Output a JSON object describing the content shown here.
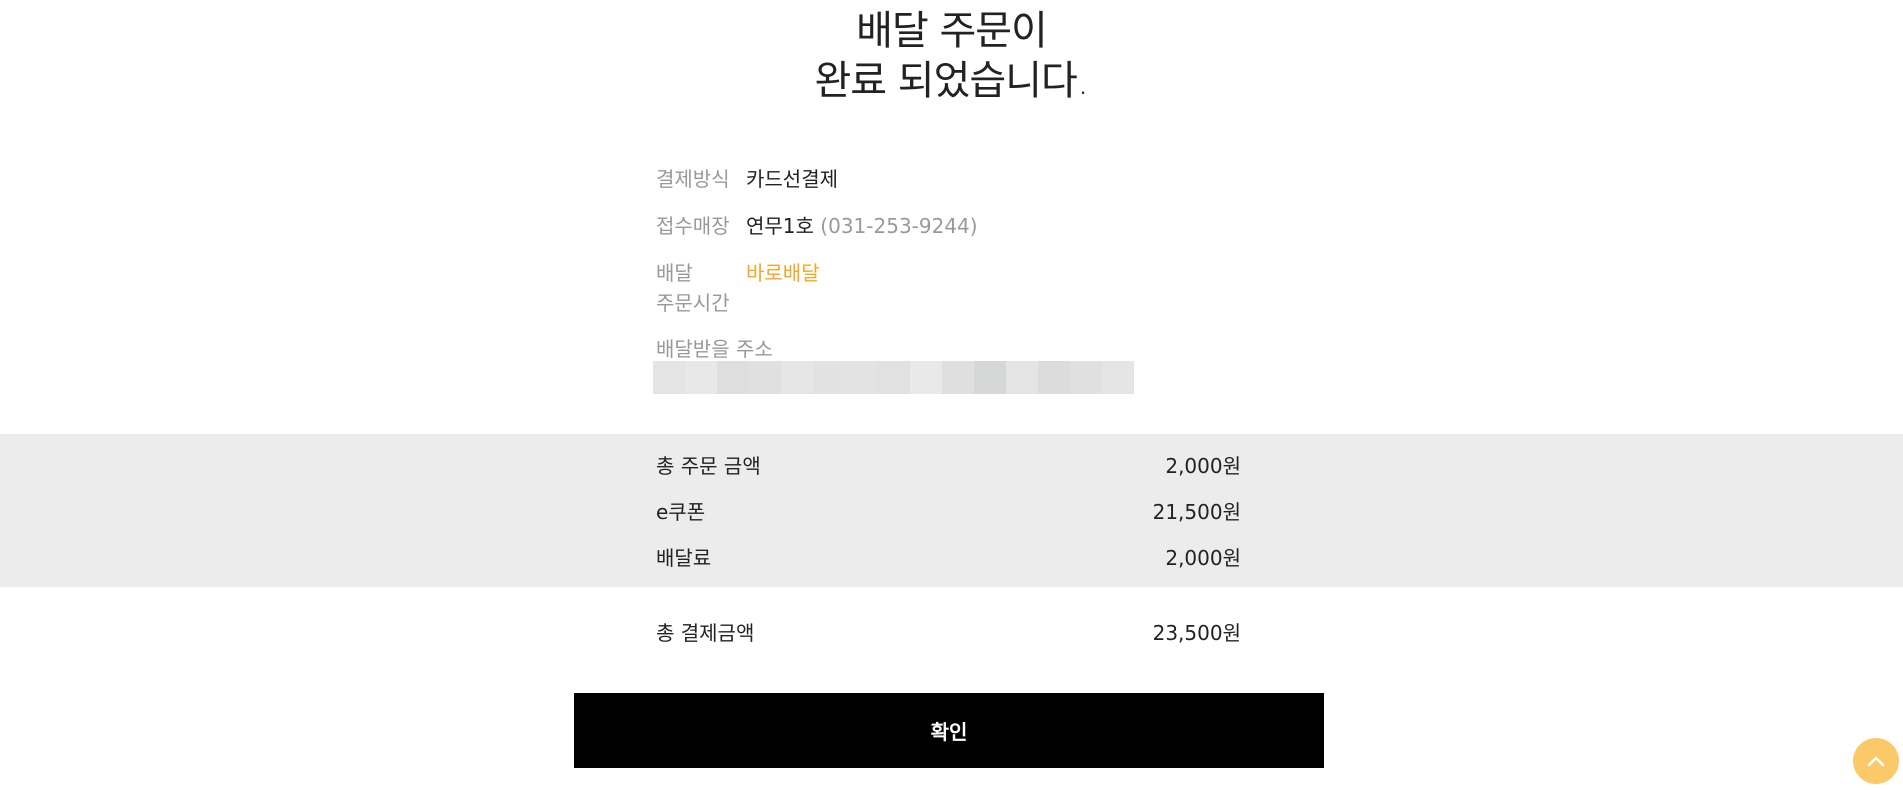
{
  "heading": {
    "line1": "배달 주문이",
    "line2": "완료 되었습니다."
  },
  "info": {
    "payment_label": "결제방식",
    "payment_value": "카드선결제",
    "store_label": "접수매장",
    "store_name": "연무1호",
    "store_phone": "(031-253-9244)",
    "delivery_label_1": "배달",
    "delivery_label_2": "주문시간",
    "delivery_value": "바로배달",
    "address_label": "배달받을 주소"
  },
  "summary": {
    "rows": [
      {
        "label": "총 주문 금액",
        "value": "2,000원"
      },
      {
        "label": "e쿠폰",
        "value": "21,500원"
      },
      {
        "label": "배달료",
        "value": "2,000원"
      }
    ]
  },
  "total": {
    "label": "총 결제금액",
    "value": "23,500원"
  },
  "confirm_label": "확인",
  "colors": {
    "accent_orange": "#f5a623",
    "summary_bg": "#ececec",
    "top_button": "#fcc968"
  },
  "icons": {
    "top_button": "chevron-up-icon"
  }
}
